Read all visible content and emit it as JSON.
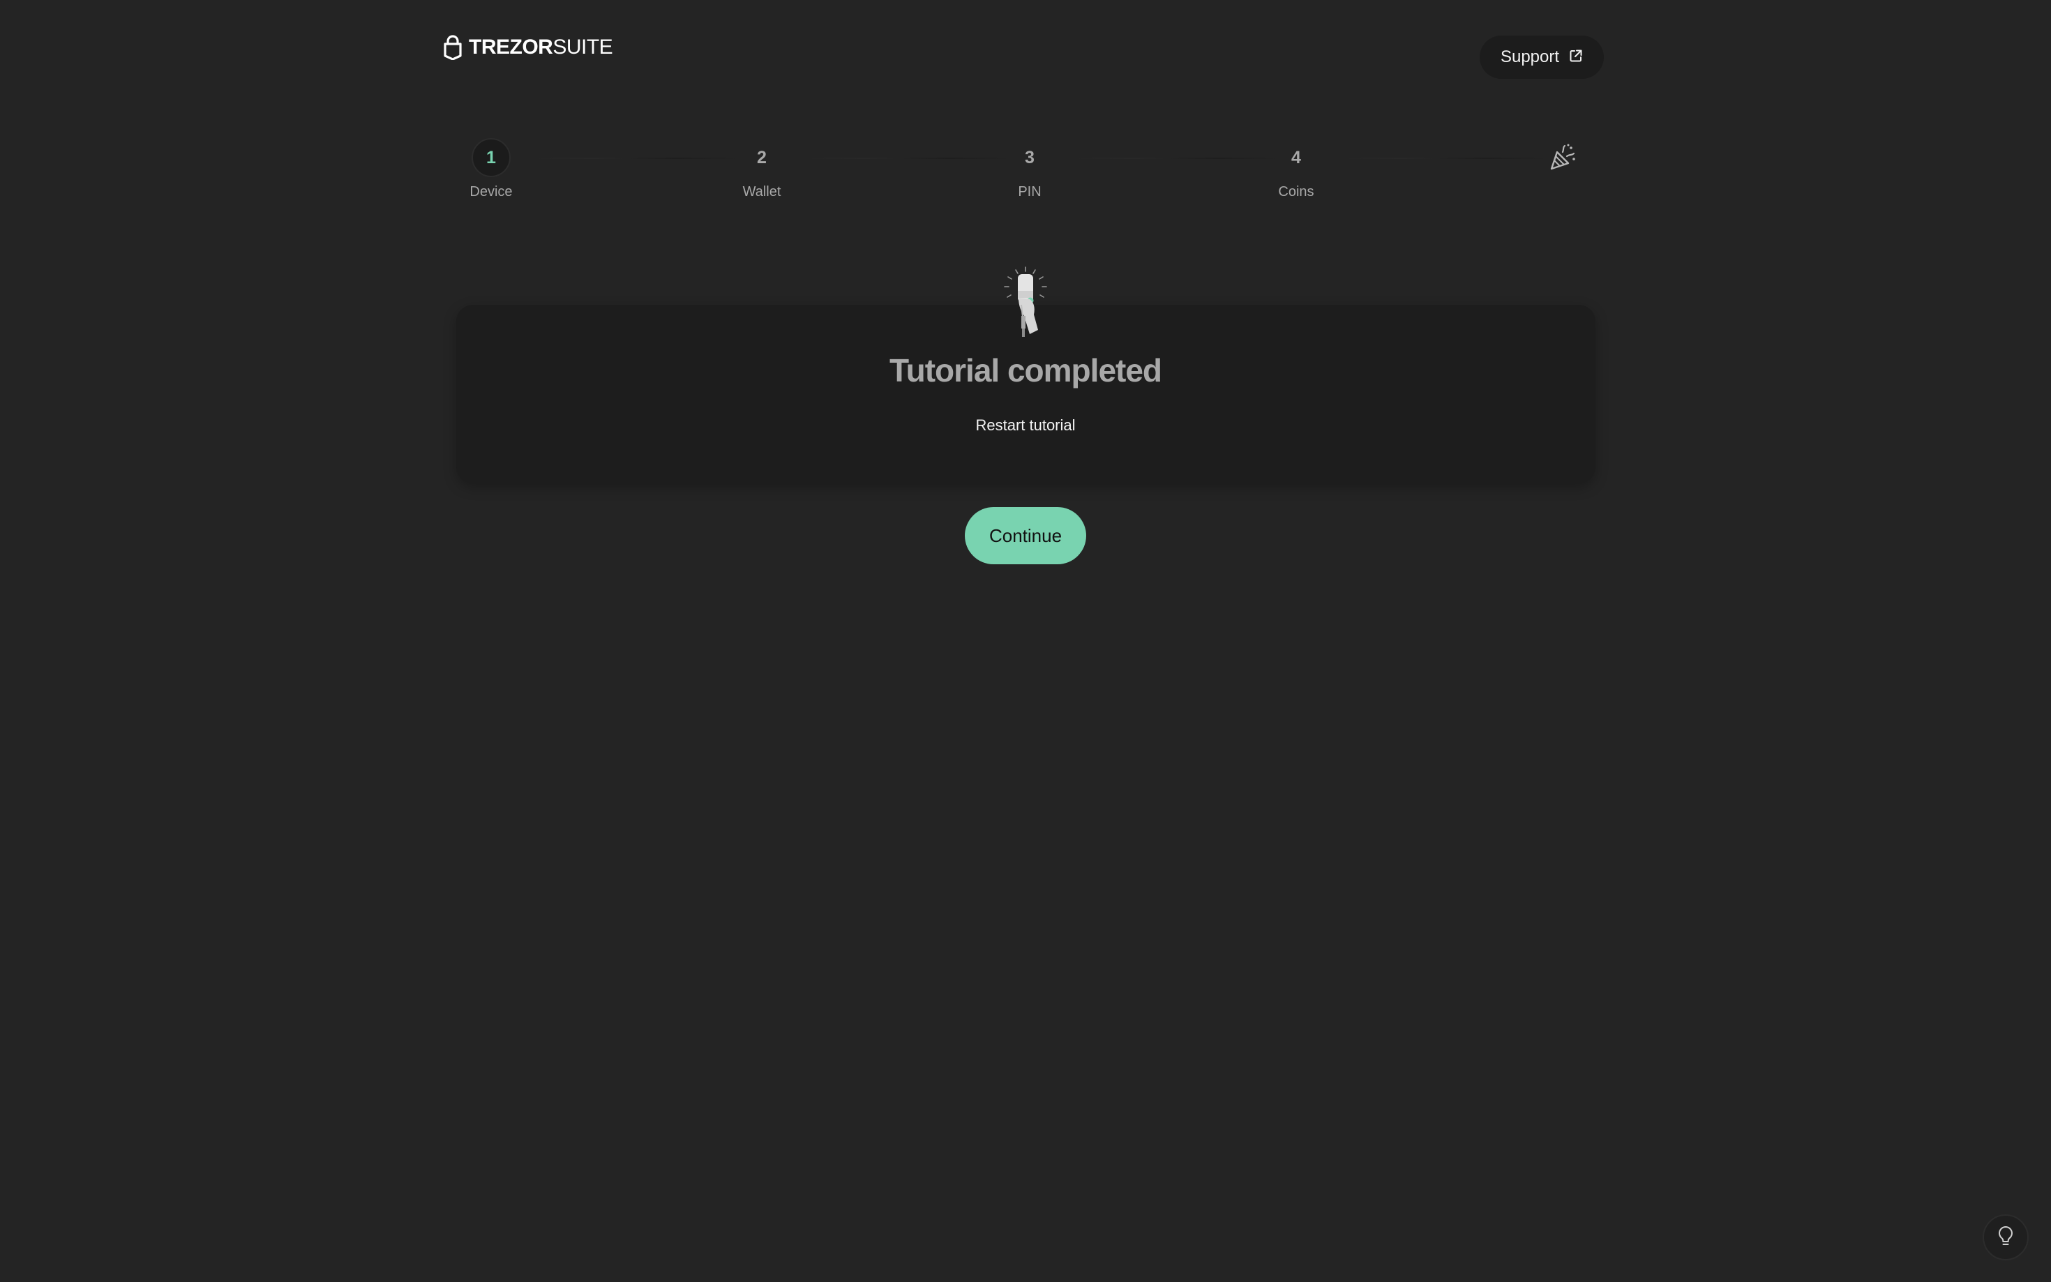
{
  "header": {
    "logo_bold": "TREZOR",
    "logo_light": "SUITE",
    "support_label": "Support",
    "support_icon": "external-link-icon",
    "logo_icon": "padlock-icon"
  },
  "stepper": {
    "steps": [
      {
        "number": "1",
        "label": "Device",
        "active": true
      },
      {
        "number": "2",
        "label": "Wallet",
        "active": false
      },
      {
        "number": "3",
        "label": "PIN",
        "active": false
      },
      {
        "number": "4",
        "label": "Coins",
        "active": false
      }
    ],
    "final_icon": "party-popper-icon"
  },
  "tutorial": {
    "illustration": "hand-holding-device-icon",
    "title": "Tutorial completed",
    "restart_label": "Restart tutorial"
  },
  "actions": {
    "continue_label": "Continue"
  },
  "floating": {
    "tips_icon": "lightbulb-icon"
  },
  "colors": {
    "background": "#242424",
    "card": "#1d1d1d",
    "accent": "#79d3b0"
  }
}
